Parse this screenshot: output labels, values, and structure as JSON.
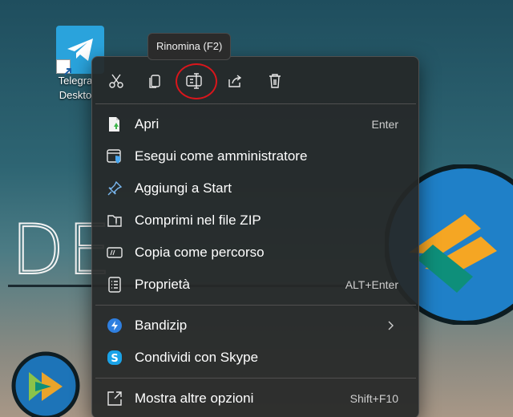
{
  "desktop": {
    "wallpaper_text": "DE",
    "icons": [
      {
        "label_line1": "Telegra",
        "label_line2": "Deskto",
        "icon": "telegram-icon"
      }
    ]
  },
  "tooltip": {
    "text": "Rinomina (F2)"
  },
  "context_menu": {
    "toolbar": [
      {
        "name": "cut",
        "icon": "scissors-icon"
      },
      {
        "name": "copy",
        "icon": "copy-icon"
      },
      {
        "name": "rename",
        "icon": "rename-icon",
        "highlighted": true
      },
      {
        "name": "share",
        "icon": "share-icon"
      },
      {
        "name": "delete",
        "icon": "trash-icon"
      }
    ],
    "items": [
      {
        "label": "Apri",
        "shortcut": "Enter",
        "icon": "open-file-icon"
      },
      {
        "label": "Esegui come amministratore",
        "shortcut": "",
        "icon": "admin-shield-icon"
      },
      {
        "label": "Aggiungi a Start",
        "shortcut": "",
        "icon": "pin-icon"
      },
      {
        "label": "Comprimi nel file ZIP",
        "shortcut": "",
        "icon": "zip-folder-icon"
      },
      {
        "label": "Copia come percorso",
        "shortcut": "",
        "icon": "copy-path-icon"
      },
      {
        "label": "Proprietà",
        "shortcut": "ALT+Enter",
        "icon": "properties-icon"
      },
      {
        "label": "Bandizip",
        "shortcut": "",
        "icon": "bandizip-icon",
        "submenu": true
      },
      {
        "label": "Condividi con Skype",
        "shortcut": "",
        "icon": "skype-icon"
      },
      {
        "label": "Mostra altre opzioni",
        "shortcut": "Shift+F10",
        "icon": "more-options-icon"
      }
    ]
  },
  "colors": {
    "menu_bg": "#262828",
    "highlight_ring": "#d9161c",
    "accent_blue": "#4aa8f0"
  }
}
